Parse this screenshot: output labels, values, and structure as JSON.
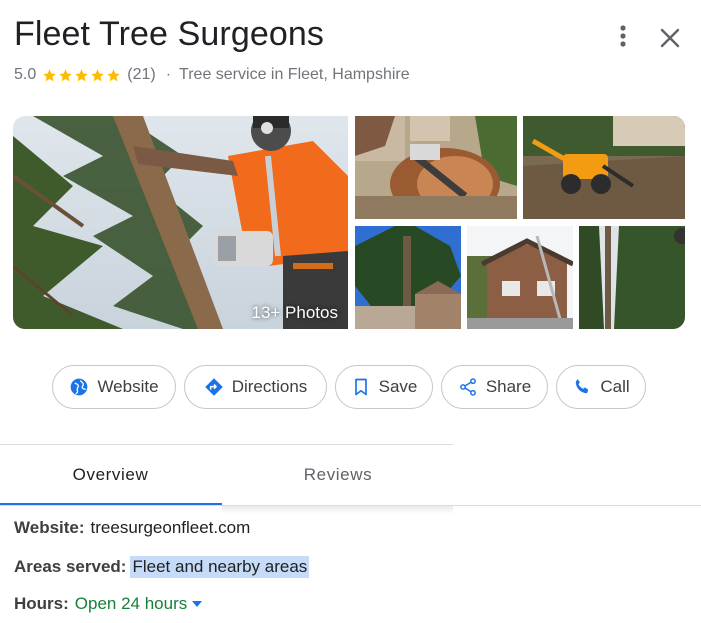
{
  "header": {
    "title": "Fleet Tree Surgeons",
    "rating": "5.0",
    "stars": 5,
    "review_count": "(21)",
    "separator": "·",
    "category": "Tree service in Fleet, Hampshire",
    "menu_icon": "more-vert-icon",
    "close_icon": "close-icon"
  },
  "photos": {
    "count_label": "13+ Photos"
  },
  "actions": [
    {
      "label": "Website",
      "icon": "globe-icon"
    },
    {
      "label": "Directions",
      "icon": "directions-icon"
    },
    {
      "label": "Save",
      "icon": "bookmark-icon"
    },
    {
      "label": "Share",
      "icon": "share-icon"
    },
    {
      "label": "Call",
      "icon": "phone-icon"
    }
  ],
  "tabs": [
    {
      "label": "Overview",
      "selected": true
    },
    {
      "label": "Reviews",
      "selected": false
    }
  ],
  "details": {
    "website_label": "Website:",
    "website_value": "treesurgeonfleet.com",
    "areas_label": "Areas served:",
    "areas_value": "Fleet and nearby areas",
    "hours_label": "Hours:",
    "hours_value": "Open 24 hours"
  },
  "colors": {
    "accent": "#1a73e8",
    "star": "#fbbc04",
    "open_green": "#188038",
    "highlight": "#c6dbf7"
  }
}
